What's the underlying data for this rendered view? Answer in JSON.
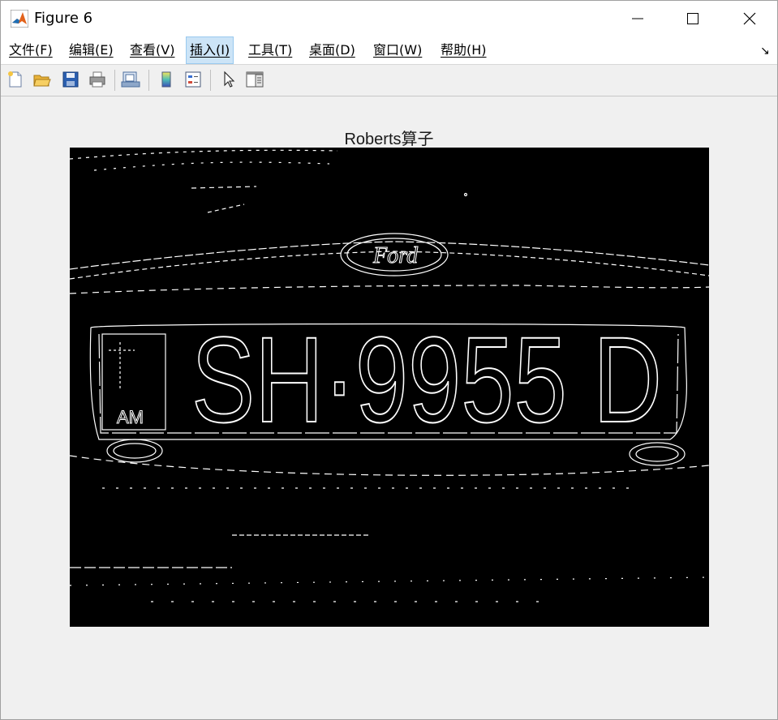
{
  "window": {
    "title": "Figure 6",
    "min_symbol": "—",
    "close_symbol": "✕"
  },
  "menu": {
    "items": [
      {
        "label": "文件(F)"
      },
      {
        "label": "编辑(E)"
      },
      {
        "label": "查看(V)"
      },
      {
        "label": "插入(I)"
      },
      {
        "label": "工具(T)"
      },
      {
        "label": "桌面(D)"
      },
      {
        "label": "窗口(W)"
      },
      {
        "label": "帮助(H)"
      }
    ],
    "active_index": 3,
    "overflow_symbol": "↘"
  },
  "toolbar": {
    "icons": [
      "new-figure-icon",
      "open-file-icon",
      "save-icon",
      "print-icon",
      "link-figure-icon",
      "insert-colorbar-icon",
      "insert-legend-icon",
      "edit-plot-icon",
      "property-inspector-icon"
    ]
  },
  "figure": {
    "axes_title": "Roberts算子",
    "plate_text": "SH·9955 D",
    "plate_left_text": "AM",
    "emblem_text": "Ford"
  },
  "colors": {
    "titlebar_bg": "#ffffff",
    "menu_active": "#cce4f7",
    "figure_bg": "#f0f0f0",
    "image_bg": "#000000",
    "edge_color": "#ffffff"
  }
}
